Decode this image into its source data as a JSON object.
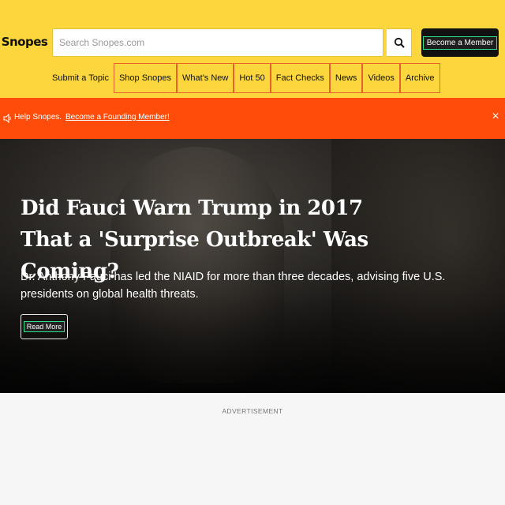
{
  "header": {
    "logo_text": "Snopes",
    "search": {
      "placeholder": "Search Snopes.com"
    },
    "member_button": "Become a Member"
  },
  "nav": {
    "items": [
      {
        "label": "Submit a Topic"
      },
      {
        "label": "Shop Snopes"
      },
      {
        "label": "What's New"
      },
      {
        "label": "Hot 50"
      },
      {
        "label": "Fact Checks"
      },
      {
        "label": "News"
      },
      {
        "label": "Videos"
      },
      {
        "label": "Archive"
      }
    ]
  },
  "banner": {
    "text": "Help Snopes.",
    "link": "Become a Founding Member!",
    "close_glyph": "×",
    "icon_glyph": "🔈",
    "color": "#ff4c0a"
  },
  "hero": {
    "headline": "Did Fauci Warn Trump in 2017 That a 'Surprise Outbreak' Was Coming?",
    "subhead": "Dr. Anthony Fauci has led the NIAID for more than three decades, advising five U.S. presidents on global health threats.",
    "read_more": "Read More"
  },
  "ad": {
    "label": "ADVERTISEMENT"
  },
  "colors": {
    "header_bg": "#fcd63d",
    "banner_bg": "#ff4c0a"
  }
}
